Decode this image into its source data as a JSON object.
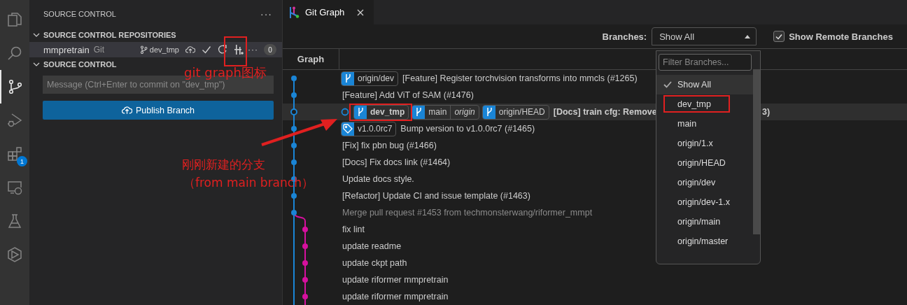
{
  "activity_bar": [
    {
      "kind": "files",
      "selected": false
    },
    {
      "kind": "search",
      "selected": false
    },
    {
      "kind": "source-control",
      "selected": true
    },
    {
      "kind": "run-debug",
      "selected": false
    },
    {
      "kind": "extensions",
      "selected": false,
      "badge": "1"
    },
    {
      "kind": "remote",
      "selected": false
    },
    {
      "kind": "testing",
      "selected": false
    },
    {
      "kind": "hexagon",
      "selected": false
    }
  ],
  "sidebar": {
    "title": "SOURCE CONTROL",
    "more": "···",
    "repositories": {
      "heading": "SOURCE CONTROL REPOSITORIES",
      "expanded": true,
      "name": "mmpretrain",
      "type": "Git",
      "branch": "dev_tmp",
      "more": "···",
      "count": "0"
    },
    "changes": {
      "heading": "SOURCE CONTROL",
      "expanded": true,
      "placeholder": "Message (Ctrl+Enter to commit on \"dev_tmp\")",
      "button": "Publish Branch"
    }
  },
  "editor": {
    "tab": {
      "title": "Git Graph",
      "selected": true
    },
    "controls": {
      "branches_label": "Branches:",
      "dropdown_value": "Show All",
      "show_remote": {
        "label": "Show Remote Branches",
        "checked": true
      }
    },
    "graph_header": "Graph",
    "commits": [
      {
        "kind": "commit",
        "refs": [
          {
            "kind": "branch",
            "name": "origin/dev"
          }
        ],
        "message": "[Feature] Register torchvision transforms into mmcls (#1265)",
        "bold": false,
        "dimmed": false,
        "selected": false
      },
      {
        "kind": "commit",
        "message": "[Feature] Add ViT of SAM (#1476)",
        "bold": false,
        "dimmed": false,
        "selected": false
      },
      {
        "kind": "head",
        "checked_out": true,
        "refs": [
          {
            "kind": "branch",
            "name": "dev_tmp",
            "bold": true
          },
          {
            "kind": "branch",
            "name": "main",
            "remote": "origin"
          },
          {
            "kind": "branch",
            "name": "origin/HEAD"
          }
        ],
        "message": "[Docs] train cfg: Remove",
        "tail": "3)",
        "bold": true,
        "dimmed": false,
        "selected": true
      },
      {
        "kind": "commit",
        "refs": [
          {
            "kind": "tag",
            "name": "v1.0.0rc7"
          }
        ],
        "message": "Bump version to v1.0.0rc7 (#1465)",
        "bold": false,
        "dimmed": false,
        "selected": false
      },
      {
        "kind": "commit",
        "message": "[Fix] fix pbn bug (#1466)",
        "bold": false,
        "dimmed": false,
        "selected": false
      },
      {
        "kind": "commit",
        "message": "[Docs] Fix docs link (#1464)",
        "bold": false,
        "dimmed": false,
        "selected": false
      },
      {
        "kind": "commit",
        "message": "Update docs style.",
        "bold": false,
        "dimmed": false,
        "selected": false
      },
      {
        "kind": "commit",
        "message": "[Refactor] Update CI and issue template (#1463)",
        "bold": false,
        "dimmed": false,
        "selected": false
      },
      {
        "kind": "merge",
        "message": "Merge pull request #1453 from techmonsterwang/riformer_mmpt",
        "bold": false,
        "dimmed": true,
        "selected": false
      },
      {
        "kind": "side",
        "message": "fix lint",
        "bold": false,
        "dimmed": false,
        "selected": false
      },
      {
        "kind": "side",
        "message": "update readme",
        "bold": false,
        "dimmed": false,
        "selected": false
      },
      {
        "kind": "side",
        "message": "update ckpt path",
        "bold": false,
        "dimmed": false,
        "selected": false
      },
      {
        "kind": "side",
        "message": "update riformer mmpretrain",
        "bold": false,
        "dimmed": false,
        "selected": false
      },
      {
        "kind": "side",
        "message": "update riformer mmpretrain",
        "bold": false,
        "dimmed": false,
        "selected": false
      }
    ],
    "dropdown": {
      "filter_placeholder": "Filter Branches...",
      "items": [
        {
          "label": "Show All",
          "selected": true
        },
        {
          "label": "dev_tmp",
          "selected": false
        },
        {
          "label": "main",
          "selected": false
        },
        {
          "label": "origin/1.x",
          "selected": false
        },
        {
          "label": "origin/HEAD",
          "selected": false
        },
        {
          "label": "origin/dev",
          "selected": false
        },
        {
          "label": "origin/dev-1.x",
          "selected": false
        },
        {
          "label": "origin/main",
          "selected": false
        },
        {
          "label": "origin/master",
          "selected": false
        }
      ]
    }
  },
  "annotations": {
    "icon_note": "git graph图标",
    "branch_note_line1": "刚刚新建的分支",
    "branch_note_line2": "（from main branch）"
  }
}
